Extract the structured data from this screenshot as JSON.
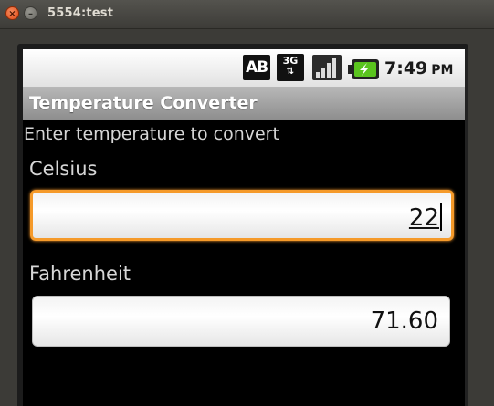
{
  "window": {
    "title": "5554:test",
    "close_icon": "close-icon",
    "minimize_icon": "minimize-icon"
  },
  "statusbar": {
    "ab_label": "AB",
    "network_label": "3G",
    "time": "7:49",
    "ampm": "PM",
    "icons": [
      "ab-icon",
      "3g-data-icon",
      "signal-icon",
      "battery-charging-icon"
    ]
  },
  "app": {
    "title": "Temperature Converter",
    "instruction": "Enter temperature to convert"
  },
  "celsius": {
    "label": "Celsius",
    "value": "22"
  },
  "fahrenheit": {
    "label": "Fahrenheit",
    "value": "71.60"
  },
  "colors": {
    "focus_border": "#f59a2a",
    "battery_green": "#5ac41e",
    "appbar": "#a3a3a3"
  }
}
